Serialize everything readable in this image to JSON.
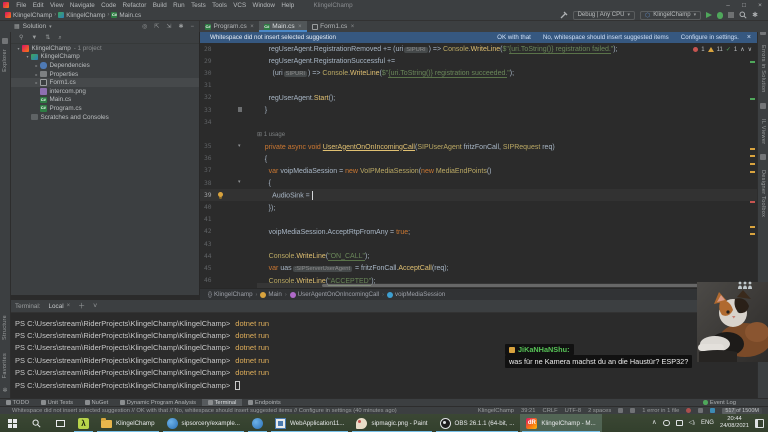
{
  "title_bar": {
    "menu": [
      "File",
      "Edit",
      "View",
      "Navigate",
      "Code",
      "Refactor",
      "Build",
      "Run",
      "Tests",
      "Tools",
      "VCS",
      "Window",
      "Help"
    ],
    "title": "KlingelChamp",
    "window_controls": {
      "minimize": "–",
      "maximize": "□",
      "close": "×"
    }
  },
  "nav_bar": {
    "breadcrumbs": [
      {
        "label": "KlingelChamp",
        "icon": "ci-sol"
      },
      {
        "label": "KlingelChamp",
        "icon": "ci-proj"
      },
      {
        "label": "Main.cs",
        "icon": "ci-cs"
      }
    ],
    "debug_config": "Debug | Any CPU",
    "run_config": "KlingelChamp"
  },
  "solution_panel": {
    "header": "Solution",
    "tree": [
      {
        "label": "KlingelChamp",
        "suffix": "- 1 project",
        "icon": "ic-solution",
        "indent": 0,
        "chevron": "▾"
      },
      {
        "label": "KlingelChamp",
        "suffix": "",
        "icon": "ic-project",
        "indent": 1,
        "chevron": "▾"
      },
      {
        "label": "Dependencies",
        "suffix": "",
        "icon": "ic-dependencies",
        "indent": 2,
        "chevron": "▸"
      },
      {
        "label": "Properties",
        "suffix": "",
        "icon": "ic-properties",
        "indent": 2,
        "chevron": "▸"
      },
      {
        "label": "Form1.cs",
        "suffix": "",
        "icon": "ic-form",
        "indent": 2,
        "chevron": "▸",
        "selected": true
      },
      {
        "label": "intercom.png",
        "suffix": "",
        "icon": "ic-image",
        "indent": 2,
        "chevron": ""
      },
      {
        "label": "Main.cs",
        "suffix": "",
        "icon": "ic-csfile",
        "indent": 2,
        "chevron": ""
      },
      {
        "label": "Program.cs",
        "suffix": "",
        "icon": "ic-csfile",
        "indent": 2,
        "chevron": ""
      },
      {
        "label": "Scratches and Consoles",
        "suffix": "",
        "icon": "ic-scratches",
        "indent": 1,
        "chevron": ""
      }
    ]
  },
  "tabs": [
    {
      "label": "Program.cs",
      "icon": "t-cs",
      "icon_text": "C#",
      "active": false
    },
    {
      "label": "Main.cs",
      "icon": "t-cs",
      "icon_text": "C#",
      "active": true
    },
    {
      "label": "Form1.cs",
      "icon": "t-form",
      "icon_text": "",
      "active": false
    }
  ],
  "notification": {
    "message": "Whitespace did not insert selected suggestion",
    "actions": [
      "OK with that",
      "No, whitespace should insert suggested items",
      "Configure in settings."
    ],
    "close": "×"
  },
  "editor": {
    "inspection": {
      "errors": "1",
      "warnings": "11",
      "checks": "1"
    },
    "annotation": "1 usage",
    "lines": [
      {
        "num": "28",
        "spans": [
          [
            "v",
            "      regUserAgent.RegistrationRemoved += ("
          ],
          [
            "v",
            "uri"
          ],
          [
            "h",
            "SIPURI"
          ],
          [
            "v",
            ") => "
          ],
          [
            "t",
            "Console"
          ],
          [
            "v",
            "."
          ],
          [
            "m",
            "WriteLine"
          ],
          [
            "v",
            "("
          ],
          [
            "s",
            "$\""
          ],
          [
            "su",
            "{uri.ToString()} registration failed."
          ],
          [
            "s",
            "\""
          ],
          [
            "v",
            ");"
          ]
        ]
      },
      {
        "num": "29",
        "spans": [
          [
            "v",
            "      regUserAgent.RegistrationSuccessful +="
          ]
        ]
      },
      {
        "num": "30",
        "spans": [
          [
            "v",
            "        ("
          ],
          [
            "v",
            "uri"
          ],
          [
            "h",
            "SIPURI"
          ],
          [
            "v",
            ") => "
          ],
          [
            "t",
            "Console"
          ],
          [
            "v",
            "."
          ],
          [
            "m",
            "WriteLine"
          ],
          [
            "v",
            "("
          ],
          [
            "s",
            "$\""
          ],
          [
            "su",
            "{uri.ToString()} registration succeeded."
          ],
          [
            "s",
            "\""
          ],
          [
            "v",
            ");"
          ]
        ]
      },
      {
        "num": "31",
        "spans": []
      },
      {
        "num": "32",
        "spans": [
          [
            "v",
            "      regUserAgent."
          ],
          [
            "m",
            "Start"
          ],
          [
            "v",
            "();"
          ]
        ]
      },
      {
        "num": "33",
        "gutter": "mark",
        "spans": [
          [
            "v",
            "    }"
          ]
        ]
      },
      {
        "num": "34",
        "spans": []
      },
      {
        "annotation": true,
        "text": "1 usage"
      },
      {
        "num": "35",
        "gutter": "fold",
        "spans": [
          [
            "k",
            "    private async void "
          ],
          [
            "md",
            "UserAgentOnOnIncomingCall"
          ],
          [
            "v",
            "("
          ],
          [
            "t",
            "SIPUserAgent"
          ],
          [
            "v",
            " fritzFonCall, "
          ],
          [
            "t",
            "SIPRequest"
          ],
          [
            "v",
            " req)"
          ]
        ]
      },
      {
        "num": "36",
        "spans": [
          [
            "v",
            "    {"
          ]
        ]
      },
      {
        "num": "37",
        "spans": [
          [
            "k",
            "      var"
          ],
          [
            "v",
            " voipMediaSession = "
          ],
          [
            "k",
            "new"
          ],
          [
            "v",
            " "
          ],
          [
            "t",
            "VoIPMediaSession"
          ],
          [
            "v",
            "("
          ],
          [
            "k",
            "new"
          ],
          [
            "v",
            " "
          ],
          [
            "t",
            "MediaEndPoints"
          ],
          [
            "v",
            "()"
          ]
        ]
      },
      {
        "num": "38",
        "gutter": "fold",
        "spans": [
          [
            "v",
            "      {"
          ]
        ]
      },
      {
        "num": "39",
        "gutter": "bulb",
        "current": true,
        "cursor": true,
        "spans": [
          [
            "v",
            "        AudioSink = "
          ]
        ]
      },
      {
        "num": "40",
        "spans": [
          [
            "v",
            "      });"
          ]
        ]
      },
      {
        "num": "41",
        "spans": []
      },
      {
        "num": "42",
        "spans": [
          [
            "v",
            "      voipMediaSession.AcceptRtpFromAny = "
          ],
          [
            "k",
            "true"
          ],
          [
            "v",
            ";"
          ]
        ]
      },
      {
        "num": "43",
        "spans": []
      },
      {
        "num": "44",
        "spans": [
          [
            "t",
            "      Console"
          ],
          [
            "v",
            "."
          ],
          [
            "m",
            "WriteLine"
          ],
          [
            "v",
            "("
          ],
          [
            "su",
            "\"ON_CALL\""
          ],
          [
            "v",
            ");"
          ]
        ]
      },
      {
        "num": "45",
        "spans": [
          [
            "k",
            "      var"
          ],
          [
            "v",
            " uas"
          ],
          [
            "h",
            ":SIPServerUserAgent"
          ],
          [
            "v",
            " = fritzFonCall."
          ],
          [
            "m",
            "AcceptCall"
          ],
          [
            "v",
            "(req);"
          ]
        ]
      },
      {
        "num": "46",
        "spans": [
          [
            "t",
            "      Console"
          ],
          [
            "v",
            "."
          ],
          [
            "m",
            "WriteLine"
          ],
          [
            "v",
            "("
          ],
          [
            "su",
            "\"ACCEPTED\""
          ],
          [
            "v",
            ");"
          ]
        ]
      }
    ],
    "breadcrumbs": [
      {
        "label": "KlingelChamp",
        "icon": "ec-braces",
        "glyph": "{}"
      },
      {
        "label": "Main",
        "icon": "ec-class",
        "glyph": ""
      },
      {
        "label": "UserAgentOnOnIncomingCall",
        "icon": "ec-method",
        "glyph": ""
      },
      {
        "label": "voipMediaSession",
        "icon": "ec-var",
        "glyph": ""
      }
    ]
  },
  "terminal": {
    "label": "Terminal:",
    "tab": "Local",
    "lines": [
      {
        "prompt": "PS C:\\Users\\stream\\RiderProjects\\KlingelChamp\\KlingelChamp>",
        "command": "dotnet run",
        "cursor": false
      },
      {
        "prompt": "PS C:\\Users\\stream\\RiderProjects\\KlingelChamp\\KlingelChamp>",
        "command": "dotnet run",
        "cursor": false
      },
      {
        "prompt": "PS C:\\Users\\stream\\RiderProjects\\KlingelChamp\\KlingelChamp>",
        "command": "dotnet run",
        "cursor": false
      },
      {
        "prompt": "PS C:\\Users\\stream\\RiderProjects\\KlingelChamp\\KlingelChamp>",
        "command": "dotnet run",
        "cursor": false
      },
      {
        "prompt": "PS C:\\Users\\stream\\RiderProjects\\KlingelChamp\\KlingelChamp>",
        "command": "dotnet run",
        "cursor": false
      },
      {
        "prompt": "PS C:\\Users\\stream\\RiderProjects\\KlingelChamp\\KlingelChamp>",
        "command": "",
        "cursor": true
      }
    ]
  },
  "bottom_stripe": {
    "buttons": [
      {
        "label": "TODO",
        "active": false
      },
      {
        "label": "Unit Tests",
        "active": false
      },
      {
        "label": "NuGet",
        "active": false
      },
      {
        "label": "Dynamic Program Analysis",
        "active": false
      },
      {
        "label": "Terminal",
        "active": true
      },
      {
        "label": "Endpoints",
        "active": false
      }
    ],
    "event_log": "Event Log"
  },
  "status_bar": {
    "message": "Whitespace did not insert selected suggestion // OK with that // No, whitespace should insert suggested items // Configure in settings (40 minutes ago)",
    "segments": [
      "KlingelChamp",
      "39:21",
      "CRLF",
      "UTF-8",
      "2 spaces"
    ],
    "error_text": "1 error in 1 file",
    "memory": "517 of 1500M"
  },
  "side_labels": {
    "left_top": "Explorer",
    "left_bottom": [
      "Structure",
      "Favorites"
    ],
    "right": [
      "Errors in Solution",
      "IL Viewer",
      "Designer Toolbox"
    ]
  },
  "taskbar": {
    "apps": [
      {
        "label": "",
        "icon": "ai-lambda",
        "icon_text": "λ",
        "active": false
      },
      {
        "label": "KlingelChamp",
        "icon": "ai-folder",
        "icon_text": "",
        "active": false
      },
      {
        "label": "sipsorcery/example...",
        "icon": "ai-blue",
        "icon_text": "",
        "active": false
      },
      {
        "label": "",
        "icon": "ai-blue",
        "icon_text": "",
        "active": false
      },
      {
        "label": "WebApplication11...",
        "icon": "ai-webapp",
        "icon_text": "",
        "active": false
      },
      {
        "label": "sipmagic.png - Paint",
        "icon": "ai-paint",
        "icon_text": "",
        "active": false
      },
      {
        "label": "OBS 26.1.1 (64-bit, ...",
        "icon": "ai-obs",
        "icon_text": "",
        "active": false
      },
      {
        "label": "KlingelChamp - M...",
        "icon": "ai-rider",
        "icon_text": "dR",
        "active": true
      }
    ],
    "tray": {
      "lang": "ENG",
      "time": "20:44",
      "date": "24/08/2021"
    }
  },
  "chat_overlay": {
    "user": "JiKaNHaNShu",
    "colon": ":",
    "message": "was für ne Kamera machst du an die Haustür? ESP32?"
  }
}
